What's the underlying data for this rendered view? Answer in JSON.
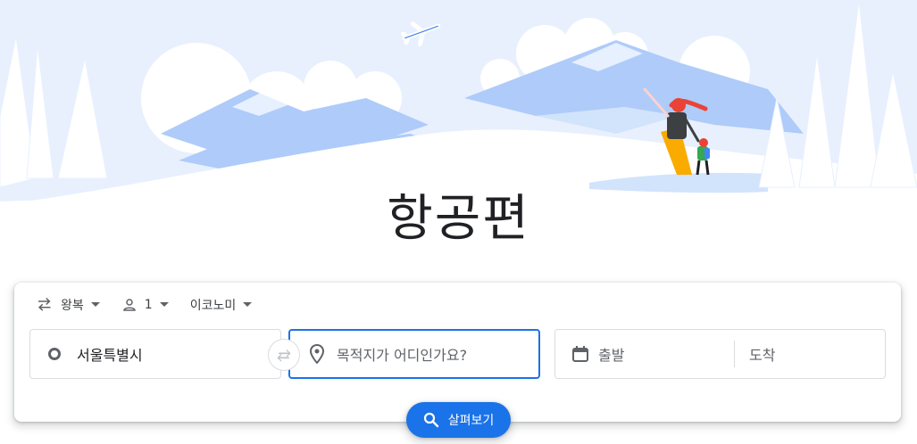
{
  "page": {
    "title": "항공편"
  },
  "options": {
    "trip_type": "왕복",
    "passengers": "1",
    "cabin_class": "이코노미"
  },
  "search": {
    "origin": "서울특별시",
    "destination_placeholder": "목적지가 어디인가요?",
    "depart_label": "출발",
    "return_label": "도착"
  },
  "explore_button": {
    "label": "살펴보기"
  },
  "colors": {
    "accent": "#1a73e8",
    "hero_sky": "#e8f0fe",
    "mountain": "#aecbfa",
    "text": "#202124",
    "muted": "#5f6368"
  },
  "icons": [
    "swap-arrows-icon",
    "person-icon",
    "chevron-down-icon",
    "circle-icon",
    "location-pin-icon",
    "calendar-icon",
    "search-icon",
    "airplane-icon"
  ]
}
